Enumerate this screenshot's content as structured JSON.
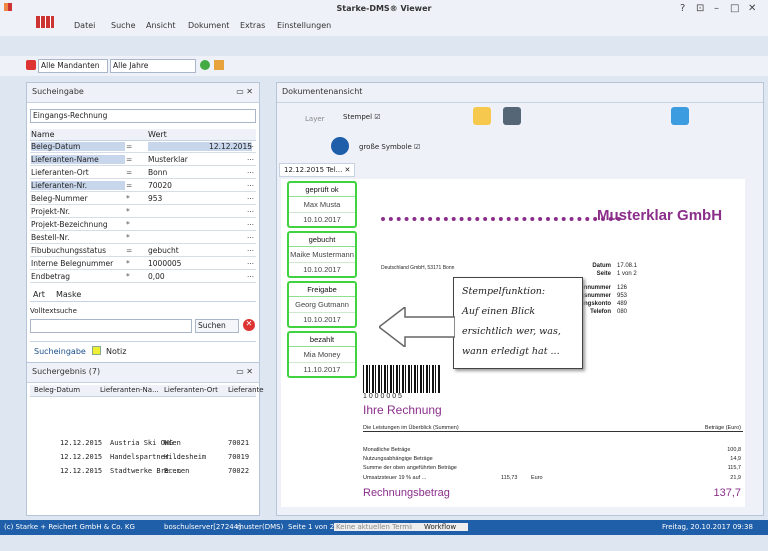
{
  "app": {
    "title": "Starke-DMS® Viewer",
    "win_controls": [
      "?",
      "⊡",
      "–",
      "□",
      "✕"
    ]
  },
  "menu": [
    "Datei",
    "Suche",
    "Ansicht",
    "Dokument",
    "Extras",
    "Einstellungen"
  ],
  "toolbar": {
    "mandant": "Alle Mandanten",
    "jahr": "Alle Jahre"
  },
  "search_panel": {
    "title": "Sucheingabe",
    "form": "Eingangs-Rechnung",
    "col_name": "Name",
    "col_value": "Wert",
    "rows": [
      {
        "name": "Beleg-Datum",
        "op": "=",
        "value": "12.12.2015"
      },
      {
        "name": "Lieferanten-Name",
        "op": "=",
        "value": "Musterklar"
      },
      {
        "name": "Lieferanten-Ort",
        "op": "=",
        "value": "Bonn"
      },
      {
        "name": "Lieferanten-Nr.",
        "op": "=",
        "value": "70020"
      },
      {
        "name": "Beleg-Nummer",
        "op": "*",
        "value": "953"
      },
      {
        "name": "Projekt-Nr.",
        "op": "*",
        "value": ""
      },
      {
        "name": "Projekt-Bezeichnung",
        "op": "*",
        "value": ""
      },
      {
        "name": "Bestell-Nr.",
        "op": "*",
        "value": ""
      },
      {
        "name": "Fibubuchungsstatus",
        "op": "=",
        "value": "gebucht"
      },
      {
        "name": "Interne Belegnummer",
        "op": "*",
        "value": "1000005"
      },
      {
        "name": "Endbetrag",
        "op": "*",
        "value": "0,00"
      }
    ],
    "tabs": [
      "Art",
      "Maske"
    ],
    "volltext_label": "Volltextsuche",
    "search_btn": "Suchen",
    "bottom_tabs": [
      "Sucheingabe",
      "Notiz"
    ]
  },
  "results": {
    "title": "Suchergebnis (7)",
    "cols": [
      "Beleg-Datum",
      "Lieferanten-Na...",
      "Lieferanten-Ort",
      "Lieferante"
    ],
    "rows": [
      {
        "date": "12.12.2015",
        "name": "Austria Ski OHG",
        "ort": "Wien",
        "nr": "70021"
      },
      {
        "date": "12.12.2015",
        "name": "Handelspartner ...",
        "ort": "Hildesheim",
        "nr": "70019"
      },
      {
        "date": "12.12.2015",
        "name": "Stadtwerke Bre...",
        "ort": "Bremen",
        "nr": "70022"
      }
    ]
  },
  "doc_view": {
    "title": "Dokumentenansicht",
    "layer": "Layer",
    "stempel": "Stempel",
    "grosse_symbole": "große Symbole",
    "doc_tab": "12.12.2015 Tel..."
  },
  "stamps": [
    {
      "title": "geprüft ok",
      "name": "Max Musta",
      "date": "10.10.2017"
    },
    {
      "title": "gebucht",
      "name": "Maike Mustermann",
      "date": "10.10.2017"
    },
    {
      "title": "Freigabe",
      "name": "Georg Gutmann",
      "date": "10.10.2017"
    },
    {
      "title": "bezahlt",
      "name": "Mia Money",
      "date": "11.10.2017"
    }
  ],
  "callout": [
    "Stempelfunktion:",
    "Auf einen Blick",
    "ersichtlich wer, was,",
    "wann erledigt hat ..."
  ],
  "doc": {
    "company": "Musterklar GmbH",
    "sender": "Deutschland GmbH, 53171 Bonn",
    "info": [
      [
        "Datum",
        "17.08.1"
      ],
      [
        "Seite",
        "1 von 2"
      ],
      [
        "Kundennummer",
        "126"
      ],
      [
        "Rechnungsnummer",
        "953"
      ],
      [
        "Buchungskonto",
        "489"
      ],
      [
        "Telefon",
        "080"
      ]
    ],
    "barcode": "1 0 0 0 0 0 5",
    "heading": "Ihre Rechnung",
    "summary_title": "Die Leistungen im Überblick (Summen)",
    "betrage": "Beträge (Euro)",
    "lines": [
      [
        "Monatliche Beträge",
        "100,8"
      ],
      [
        "Nutzungsabhängige Beträge",
        "14,9"
      ],
      [
        "Summe der oben angeführten Beträge",
        "115,7"
      ]
    ],
    "ust": "Umsatzsteuer 19 % auf ...",
    "ust_base": "115,73",
    "euro": "Euro",
    "ust_val": "21,9",
    "rechnungsbetrag": "Rechnungsbetrag",
    "rb_val": "137,7"
  },
  "status": {
    "company": "(c) Starke + Reichert GmbH & Co. KG",
    "server": "boschulserver[27244]",
    "user": "muster",
    "dms": "(DMS)",
    "page": "Seite 1 von 2",
    "termine": "Keine aktuellen Termine",
    "workflow": "Workflow",
    "date": "Freitag, 20.10.2017 09:38"
  },
  "colors": {
    "accent": "#1f5ea8",
    "stamp_border": "#3fd43f",
    "company": "#8b2f8b"
  }
}
